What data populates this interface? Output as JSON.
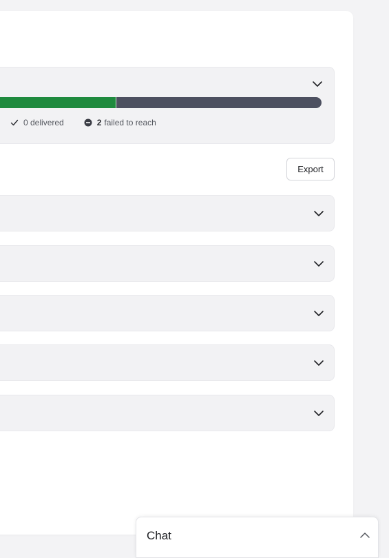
{
  "summary": {
    "progress_fraction": 0.388,
    "colors": {
      "delivered": "#1f8a3e",
      "remaining": "#4d5060"
    },
    "stats": [
      {
        "icon": "check-icon",
        "count": "",
        "label": "0 delivered"
      },
      {
        "icon": "minus-circle-icon",
        "count": "2",
        "label": "failed to reach"
      }
    ]
  },
  "toolbar": {
    "export_label": "Export"
  },
  "rows": [
    {
      "id": "row-1"
    },
    {
      "id": "row-2"
    },
    {
      "id": "row-3"
    },
    {
      "id": "row-4"
    },
    {
      "id": "row-5"
    }
  ],
  "chat": {
    "title": "Chat"
  }
}
